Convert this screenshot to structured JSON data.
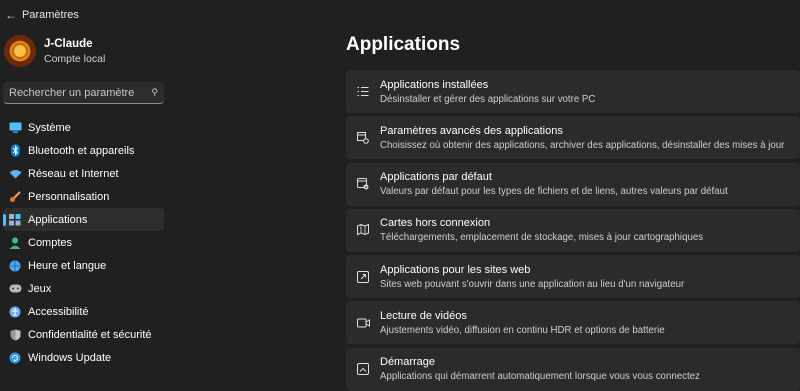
{
  "window": {
    "title": "Paramètres"
  },
  "profile": {
    "name": "J-Claude",
    "account_type": "Compte local"
  },
  "search": {
    "placeholder": "Rechercher un paramètre"
  },
  "sidebar": {
    "items": [
      {
        "label": "Système",
        "icon": "display-icon",
        "color": "#4cc2ff",
        "active": false
      },
      {
        "label": "Bluetooth et appareils",
        "icon": "bluetooth-icon",
        "color": "#0078d4",
        "active": false
      },
      {
        "label": "Réseau et Internet",
        "icon": "wifi-icon",
        "color": "#5fb2f2",
        "active": false
      },
      {
        "label": "Personnalisation",
        "icon": "brush-icon",
        "color": "#f0a35e",
        "active": false
      },
      {
        "label": "Applications",
        "icon": "apps-icon",
        "color": "#9ab4d8",
        "active": true
      },
      {
        "label": "Comptes",
        "icon": "person-icon",
        "color": "#3fbf7f",
        "active": false
      },
      {
        "label": "Heure et langue",
        "icon": "globe-clock-icon",
        "color": "#4aa8f0",
        "active": false
      },
      {
        "label": "Jeux",
        "icon": "gamepad-icon",
        "color": "#b8b8b8",
        "active": false
      },
      {
        "label": "Accessibilité",
        "icon": "accessibility-icon",
        "color": "#6ab0f5",
        "active": false
      },
      {
        "label": "Confidentialité et sécurité",
        "icon": "shield-icon",
        "color": "#9a9a9a",
        "active": false
      },
      {
        "label": "Windows Update",
        "icon": "update-icon",
        "color": "#2f9be8",
        "active": false
      }
    ]
  },
  "main": {
    "title": "Applications",
    "cards": [
      {
        "title": "Applications installées",
        "desc": "Désinstaller et gérer des applications sur votre PC",
        "icon": "list-icon"
      },
      {
        "title": "Paramètres avancés des applications",
        "desc": "Choisissez où obtenir des applications, archiver des applications, désinstaller des mises à jour",
        "icon": "app-settings-icon"
      },
      {
        "title": "Applications par défaut",
        "desc": "Valeurs par défaut pour les types de fichiers et de liens, autres valeurs par défaut",
        "icon": "default-apps-icon"
      },
      {
        "title": "Cartes hors connexion",
        "desc": "Téléchargements, emplacement de stockage, mises à jour cartographiques",
        "icon": "offline-map-icon"
      },
      {
        "title": "Applications pour les sites web",
        "desc": "Sites web pouvant s'ouvrir dans une application au lieu d'un navigateur",
        "icon": "open-external-icon"
      },
      {
        "title": "Lecture de vidéos",
        "desc": "Ajustements vidéo, diffusion en continu HDR et options de batterie",
        "icon": "video-icon"
      },
      {
        "title": "Démarrage",
        "desc": "Applications qui démarrent automatiquement lorsque vous vous connectez",
        "icon": "startup-icon"
      }
    ]
  },
  "theme": {
    "accent": "#4cc2ff",
    "background": "#202020",
    "card": "#2b2b2b"
  }
}
